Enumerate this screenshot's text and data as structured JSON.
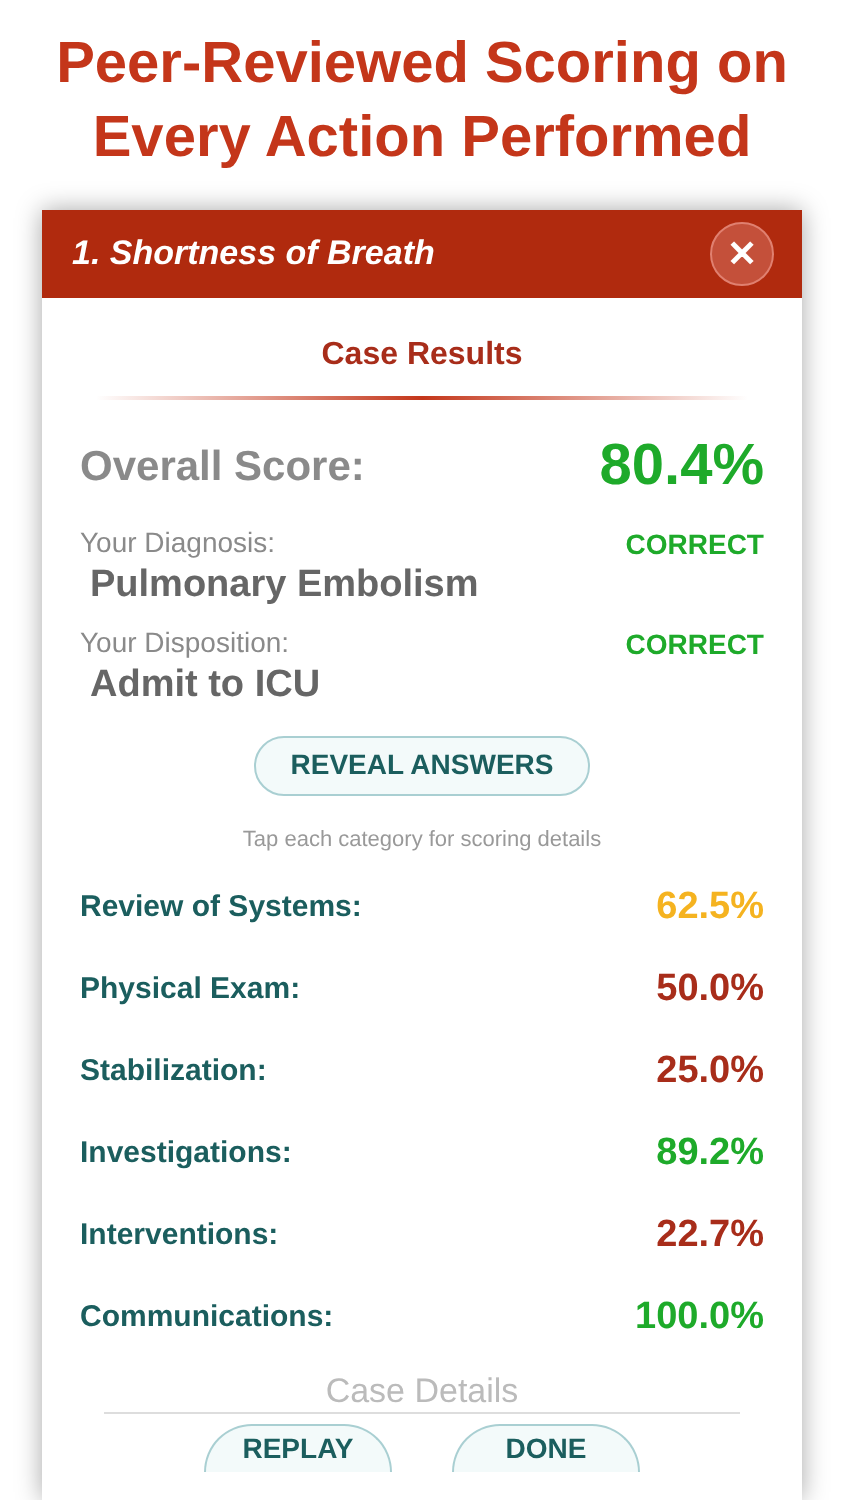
{
  "headline": "Peer-Reviewed Scoring on Every Action Performed",
  "dialog": {
    "title": "1. Shortness of Breath",
    "close_label": "✕",
    "section_title": "Case Results",
    "overall": {
      "label": "Overall Score:",
      "value": "80.4%",
      "color": "#1eaa2a"
    },
    "answers": [
      {
        "label": "Your Diagnosis:",
        "value": "Pulmonary Embolism",
        "verdict": "CORRECT",
        "color": "#1eaa2a"
      },
      {
        "label": "Your Disposition:",
        "value": "Admit to ICU",
        "verdict": "CORRECT",
        "color": "#1eaa2a"
      }
    ],
    "reveal_button": "REVEAL ANSWERS",
    "hint": "Tap each category for scoring details",
    "categories": [
      {
        "label": "Review of Systems:",
        "score": "62.5%",
        "color": "#f5b320"
      },
      {
        "label": "Physical Exam:",
        "score": "50.0%",
        "color": "#a82d1a"
      },
      {
        "label": "Stabilization:",
        "score": "25.0%",
        "color": "#a82d1a"
      },
      {
        "label": "Investigations:",
        "score": "89.2%",
        "color": "#1eaa2a"
      },
      {
        "label": "Interventions:",
        "score": "22.7%",
        "color": "#a82d1a"
      },
      {
        "label": "Communications:",
        "score": "100.0%",
        "color": "#1eaa2a"
      }
    ],
    "details_heading": "Case Details",
    "buttons": [
      "REPLAY",
      "DONE"
    ]
  }
}
